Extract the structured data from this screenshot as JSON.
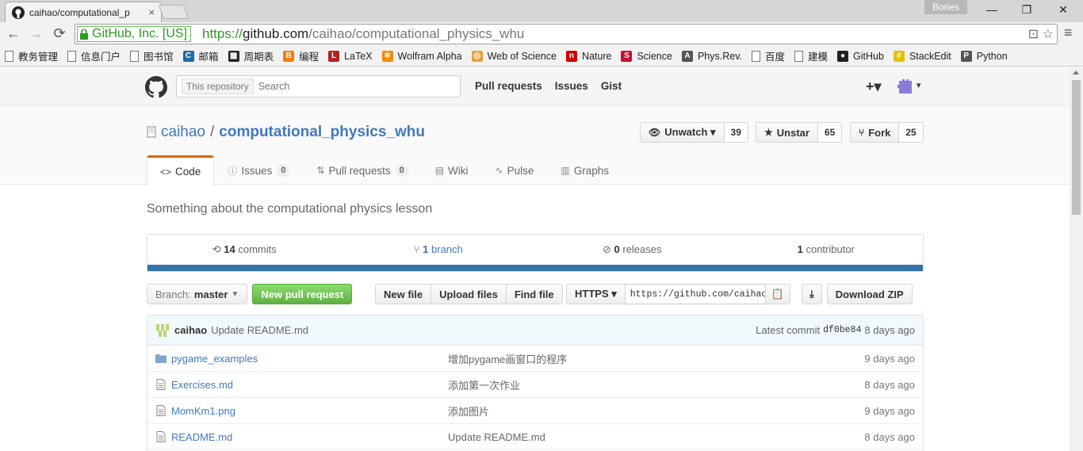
{
  "browser": {
    "tab_title": "caihao/computational_p",
    "tab_close": "×",
    "profile": "Bories",
    "win_min": "—",
    "win_restore": "❐",
    "win_close": "✕",
    "ev_label": "GitHub, Inc. [US]",
    "url_scheme": "https://",
    "url_host": "github.com",
    "url_path": "/caihao/computational_physics_whu",
    "omni_icons": "⊡ ☆",
    "menu": "≡",
    "back": "←",
    "forward": "→",
    "reload": "⟳"
  },
  "bookmarks": [
    {
      "label": "教务管理",
      "icon": "page-icon"
    },
    {
      "label": "信息门户",
      "icon": "page-icon"
    },
    {
      "label": "图书馆",
      "icon": "page-icon"
    },
    {
      "label": "邮箱",
      "icon": "mail-icon",
      "color": "#1d6aa6",
      "glyph": "C"
    },
    {
      "label": "周期表",
      "icon": "periodic-table-icon",
      "color": "#222",
      "glyph": "▦"
    },
    {
      "label": "编程",
      "icon": "blogger-icon",
      "color": "#f57d00",
      "glyph": "B"
    },
    {
      "label": "LaTeX",
      "icon": "latex-icon",
      "color": "#b22222",
      "glyph": "L"
    },
    {
      "label": "Wolfram Alpha",
      "icon": "wolfram-icon",
      "color": "#f08c00",
      "glyph": "✲"
    },
    {
      "label": "Web of Science",
      "icon": "wos-icon",
      "color": "#e6a33b",
      "glyph": "◎"
    },
    {
      "label": "Nature",
      "icon": "nature-icon",
      "color": "#cc0000",
      "glyph": "n"
    },
    {
      "label": "Science",
      "icon": "science-icon",
      "color": "#c8102e",
      "glyph": "S"
    },
    {
      "label": "Phys.Rev.",
      "icon": "aps-icon",
      "color": "#555",
      "glyph": "A"
    },
    {
      "label": "百度",
      "icon": "page-icon"
    },
    {
      "label": "建模",
      "icon": "page-icon"
    },
    {
      "label": "GitHub",
      "icon": "github-icon",
      "color": "#222",
      "glyph": "●"
    },
    {
      "label": "StackEdit",
      "icon": "stackedit-icon",
      "color": "#e5c100",
      "glyph": "#"
    },
    {
      "label": "Python",
      "icon": "python-icon",
      "color": "#555",
      "glyph": "P"
    }
  ],
  "header": {
    "scope": "This repository",
    "search_placeholder": "Search",
    "nav": [
      "Pull requests",
      "Issues",
      "Gist"
    ],
    "plus": "+▾",
    "avatar_caret": "▾"
  },
  "repo": {
    "owner": "caihao",
    "separator": "/",
    "name": "computational_physics_whu",
    "watch_label": "Unwatch ▾",
    "watch_count": "39",
    "star_label": "Unstar",
    "star_count": "65",
    "fork_label": "Fork",
    "fork_count": "25",
    "tabs": [
      {
        "label": "Code",
        "icon": "<>",
        "counter": null
      },
      {
        "label": "Issues",
        "icon": "ⓘ",
        "counter": "0"
      },
      {
        "label": "Pull requests",
        "icon": "⇅",
        "counter": "0"
      },
      {
        "label": "Wiki",
        "icon": "▤",
        "counter": null
      },
      {
        "label": "Pulse",
        "icon": "∿",
        "counter": null
      },
      {
        "label": "Graphs",
        "icon": "▥",
        "counter": null
      }
    ],
    "description": "Something about the computational physics lesson"
  },
  "summary": {
    "commits_num": "14",
    "commits_label": "commits",
    "branch_num": "1",
    "branch_label": "branch",
    "releases_num": "0",
    "releases_label": "releases",
    "contrib_num": "1",
    "contrib_label": "contributor",
    "language_color": "#3572a5"
  },
  "filebar": {
    "branch_prefix": "Branch:",
    "branch_name": "master",
    "new_pr": "New pull request",
    "new_file": "New file",
    "upload": "Upload files",
    "find": "Find file",
    "protocol": "HTTPS ▾",
    "clone_url": "https://github.com/caihao",
    "download": "Download ZIP"
  },
  "commit": {
    "author": "caihao",
    "message": "Update README.md",
    "latest_label": "Latest commit",
    "sha": "df0be84",
    "age": "8 days ago"
  },
  "files": [
    {
      "name": "pygame_examples",
      "type": "dir",
      "message": "增加pygame画窗口的程序",
      "age": "9 days ago"
    },
    {
      "name": "Exercises.md",
      "type": "file",
      "message": "添加第一次作业",
      "age": "8 days ago"
    },
    {
      "name": "MomKm1.png",
      "type": "file",
      "message": "添加图片",
      "age": "9 days ago"
    },
    {
      "name": "README.md",
      "type": "file",
      "message": "Update README.md",
      "age": "8 days ago"
    }
  ]
}
